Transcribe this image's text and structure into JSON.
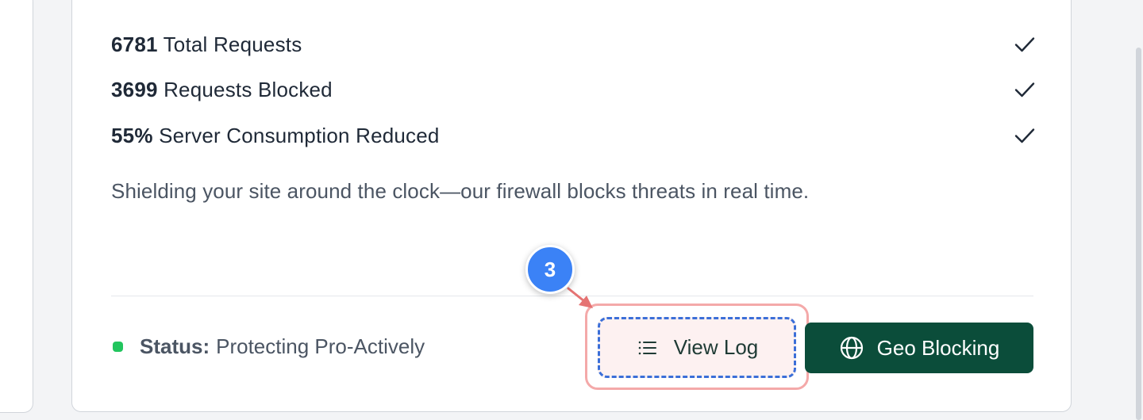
{
  "stats": [
    {
      "value": "6781",
      "label": "Total Requests",
      "icon": "check-icon"
    },
    {
      "value": "3699",
      "label": "Requests Blocked",
      "icon": "check-icon"
    },
    {
      "value": "55%",
      "label": "Server Consumption Reduced",
      "icon": "check-icon"
    }
  ],
  "description": "Shielding your site around the clock—our firewall blocks threats in real time.",
  "status": {
    "label": "Status:",
    "value": "Protecting Pro-Actively",
    "color": "#22c55e"
  },
  "buttons": {
    "view_log": {
      "label": "View Log",
      "icon": "list-icon"
    },
    "geo_blocking": {
      "label": "Geo Blocking",
      "icon": "globe-icon",
      "color": "#0b4d3a"
    }
  },
  "annotation": {
    "step_number": "3",
    "badge_color": "#3b82f6",
    "highlight_color": "#f4a9a9"
  }
}
